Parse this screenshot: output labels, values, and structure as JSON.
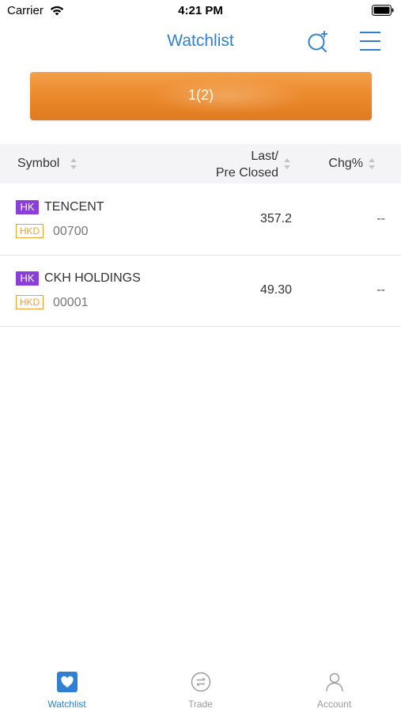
{
  "status_bar": {
    "carrier": "Carrier",
    "time": "4:21 PM"
  },
  "header": {
    "title": "Watchlist",
    "search_icon": "search-add-icon",
    "menu_icon": "menu-icon"
  },
  "banner": {
    "text": "1(2)"
  },
  "table": {
    "columns": {
      "symbol": "Symbol",
      "last_line1": "Last/",
      "last_line2": "Pre Closed",
      "chg": "Chg%"
    },
    "rows": [
      {
        "market": "HK",
        "name": "TENCENT",
        "currency": "HKD",
        "code": "00700",
        "price": "357.2",
        "chg": "--"
      },
      {
        "market": "HK",
        "name": "CKH HOLDINGS",
        "currency": "HKD",
        "code": "00001",
        "price": "49.30",
        "chg": "--"
      }
    ]
  },
  "tab_bar": {
    "items": [
      {
        "label": "Watchlist",
        "icon": "heart-icon",
        "active": true
      },
      {
        "label": "Trade",
        "icon": "transfer-icon",
        "active": false
      },
      {
        "label": "Account",
        "icon": "person-icon",
        "active": false
      }
    ]
  },
  "colors": {
    "accent": "#2f7fd3",
    "banner": "#ec8a2e",
    "market_badge": "#8b3fd9",
    "currency_badge": "#f0a030"
  }
}
